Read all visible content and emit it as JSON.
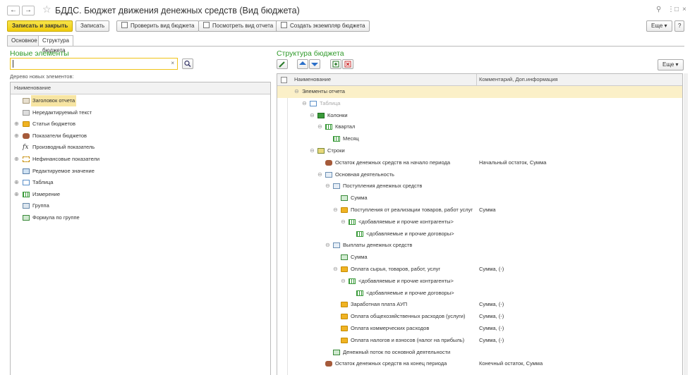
{
  "window": {
    "title": "БДДС. Бюджет движения денежных средств (Вид бюджета)",
    "back": "←",
    "forward": "→",
    "star": "☆",
    "link": "⚲",
    "menu": "⋮",
    "restore": "□",
    "close": "×"
  },
  "toolbar": {
    "save_close": "Записать и закрыть",
    "save": "Записать",
    "check": "Проверить вид бюджета",
    "view_report": "Посмотреть вид отчета",
    "create_instance": "Создать экземпляр бюджета",
    "more": "Еще ▾",
    "help": "?"
  },
  "tabs": [
    {
      "label": "Основное",
      "active": false
    },
    {
      "label": "Структура бюджета",
      "active": true
    }
  ],
  "left": {
    "title": "Новые элементы",
    "search_value": "",
    "search_clear": "×",
    "tree_label": "Дерево новых элементов:",
    "column_header": "Наименование",
    "items": [
      {
        "label": "Заголовок отчета",
        "icon": "report-title-icon",
        "expandable": false,
        "selected": true
      },
      {
        "label": "Нередактируемый текст",
        "icon": "text-icon",
        "expandable": false,
        "selected": false
      },
      {
        "label": "Статьи бюджетов",
        "icon": "folder-icon",
        "expandable": true,
        "selected": false
      },
      {
        "label": "Показатели бюджетов",
        "icon": "indicator-icon",
        "expandable": true,
        "selected": false
      },
      {
        "label": "Производный показатель",
        "icon": "fx-icon",
        "expandable": false,
        "selected": false
      },
      {
        "label": "Нефинансовые показатели",
        "icon": "nonfinancial-icon",
        "expandable": true,
        "selected": false
      },
      {
        "label": "Редактируемое значение",
        "icon": "editable-value-icon",
        "expandable": false,
        "selected": false
      },
      {
        "label": "Таблица",
        "icon": "table-icon",
        "expandable": true,
        "selected": false
      },
      {
        "label": "Измерение",
        "icon": "dimension-icon",
        "expandable": true,
        "selected": false
      },
      {
        "label": "Группа",
        "icon": "group-icon",
        "expandable": false,
        "selected": false
      },
      {
        "label": "Формула по группе",
        "icon": "group-formula-icon",
        "expandable": false,
        "selected": false
      }
    ]
  },
  "right": {
    "title": "Структура бюджета",
    "more": "Еще ▾",
    "col_name": "Наименование",
    "col_comment": "Комментарий, Доп.информация",
    "rows": [
      {
        "label": "Элементы отчета",
        "comment": "",
        "level": 0,
        "exp": "⊖",
        "icon": "",
        "selected": true,
        "dim": false
      },
      {
        "label": "Таблица",
        "comment": "",
        "level": 1,
        "exp": "⊖",
        "icon": "table-icon",
        "selected": false,
        "dim": true
      },
      {
        "label": "Колонки",
        "comment": "",
        "level": 2,
        "exp": "⊖",
        "icon": "columns-icon",
        "selected": false,
        "dim": false
      },
      {
        "label": "Квартал",
        "comment": "",
        "level": 3,
        "exp": "⊖",
        "icon": "dimension-icon",
        "selected": false,
        "dim": false
      },
      {
        "label": "Месяц",
        "comment": "",
        "level": 4,
        "exp": "",
        "icon": "dimension-icon",
        "selected": false,
        "dim": false
      },
      {
        "label": "Строки",
        "comment": "",
        "level": 2,
        "exp": "⊖",
        "icon": "rows-icon",
        "selected": false,
        "dim": false
      },
      {
        "label": "Остаток денежных средств на начало периода",
        "comment": "Начальный остаток, Сумма",
        "level": 3,
        "exp": "",
        "icon": "indicator-icon",
        "selected": false,
        "dim": false
      },
      {
        "label": "Основная деятельность",
        "comment": "",
        "level": 3,
        "exp": "⊖",
        "icon": "block-icon",
        "selected": false,
        "dim": false
      },
      {
        "label": "Поступления денежных средств",
        "comment": "",
        "level": 4,
        "exp": "⊖",
        "icon": "block-icon",
        "selected": false,
        "dim": false
      },
      {
        "label": "Сумма",
        "comment": "",
        "level": 5,
        "exp": "",
        "icon": "sum-icon",
        "selected": false,
        "dim": false
      },
      {
        "label": "Поступления от реализации товаров, работ услуг",
        "comment": "Сумма",
        "level": 5,
        "exp": "⊖",
        "icon": "folder-icon",
        "selected": false,
        "dim": false
      },
      {
        "label": "<добавляемые и прочие контрагенты>",
        "comment": "",
        "level": 6,
        "exp": "⊖",
        "icon": "dimension-icon",
        "selected": false,
        "dim": false
      },
      {
        "label": "<добавляемые и прочие договоры>",
        "comment": "",
        "level": 7,
        "exp": "",
        "icon": "dimension-icon",
        "selected": false,
        "dim": false
      },
      {
        "label": "Выплаты денежных средств",
        "comment": "",
        "level": 4,
        "exp": "⊖",
        "icon": "block-icon",
        "selected": false,
        "dim": false
      },
      {
        "label": "Сумма",
        "comment": "",
        "level": 5,
        "exp": "",
        "icon": "sum-icon",
        "selected": false,
        "dim": false
      },
      {
        "label": "Оплата сырья, товаров, работ, услуг",
        "comment": "Сумма, (-)",
        "level": 5,
        "exp": "⊖",
        "icon": "folder-icon",
        "selected": false,
        "dim": false
      },
      {
        "label": "<добавляемые и прочие контрагенты>",
        "comment": "",
        "level": 6,
        "exp": "⊖",
        "icon": "dimension-icon",
        "selected": false,
        "dim": false
      },
      {
        "label": "<добавляемые и прочие договоры>",
        "comment": "",
        "level": 7,
        "exp": "",
        "icon": "dimension-icon",
        "selected": false,
        "dim": false
      },
      {
        "label": "Заработная плата АУП",
        "comment": "Сумма, (-)",
        "level": 5,
        "exp": "",
        "icon": "folder-icon",
        "selected": false,
        "dim": false
      },
      {
        "label": "Оплата общехозяйственных расходов (услуги)",
        "comment": "Сумма, (-)",
        "level": 5,
        "exp": "",
        "icon": "folder-icon",
        "selected": false,
        "dim": false
      },
      {
        "label": "Оплата коммерческих расходов",
        "comment": "Сумма, (-)",
        "level": 5,
        "exp": "",
        "icon": "folder-icon",
        "selected": false,
        "dim": false
      },
      {
        "label": "Оплата налогов и взносов (налог на прибыль)",
        "comment": "Сумма, (-)",
        "level": 5,
        "exp": "",
        "icon": "folder-icon",
        "selected": false,
        "dim": false
      },
      {
        "label": "Денежный поток по основной деятельности",
        "comment": "",
        "level": 4,
        "exp": "",
        "icon": "group-formula-icon",
        "selected": false,
        "dim": false
      },
      {
        "label": "Остаток денежных средств на конец периода",
        "comment": "Конечный остаток, Сумма",
        "level": 3,
        "exp": "",
        "icon": "indicator-icon",
        "selected": false,
        "dim": false
      }
    ]
  },
  "colors": {
    "accent_yellow": "#f0cc10",
    "section_green": "#2f9a2a",
    "selection": "#fbf0c8"
  }
}
